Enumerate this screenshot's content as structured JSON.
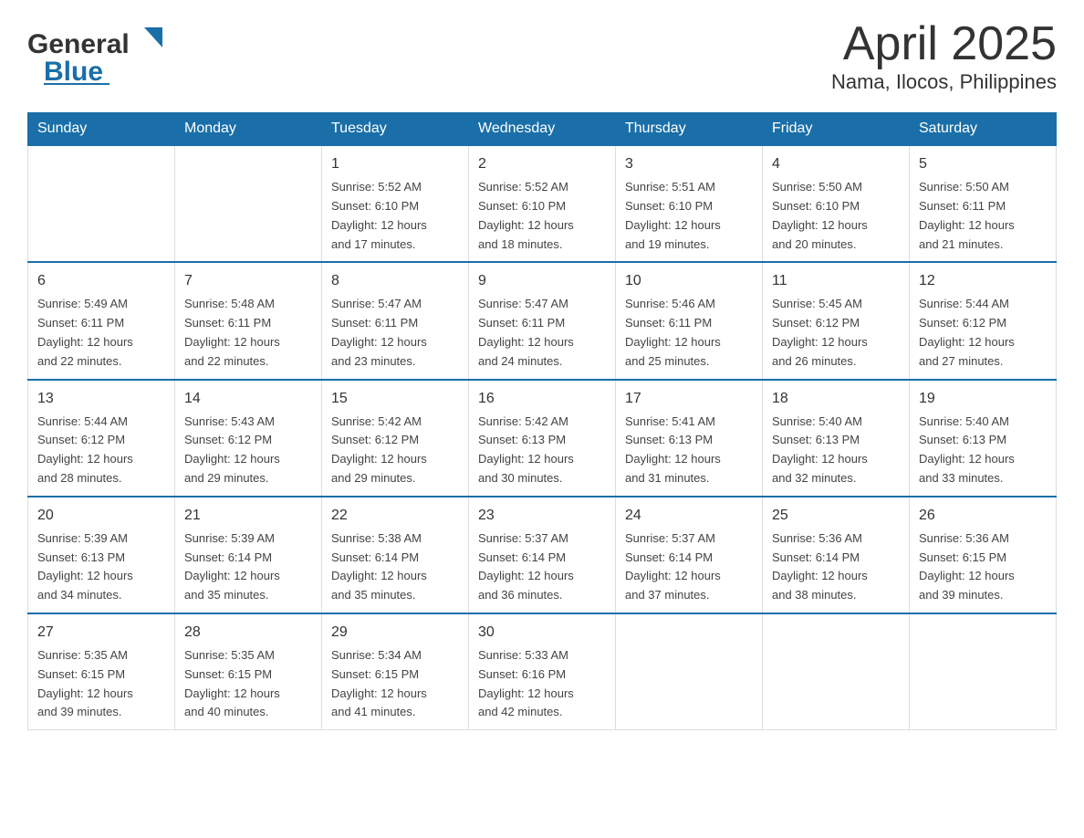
{
  "header": {
    "logo_general": "General",
    "logo_blue": "Blue",
    "month_title": "April 2025",
    "location": "Nama, Ilocos, Philippines"
  },
  "days_of_week": [
    "Sunday",
    "Monday",
    "Tuesday",
    "Wednesday",
    "Thursday",
    "Friday",
    "Saturday"
  ],
  "weeks": [
    [
      {
        "day": "",
        "info": ""
      },
      {
        "day": "",
        "info": ""
      },
      {
        "day": "1",
        "info": "Sunrise: 5:52 AM\nSunset: 6:10 PM\nDaylight: 12 hours\nand 17 minutes."
      },
      {
        "day": "2",
        "info": "Sunrise: 5:52 AM\nSunset: 6:10 PM\nDaylight: 12 hours\nand 18 minutes."
      },
      {
        "day": "3",
        "info": "Sunrise: 5:51 AM\nSunset: 6:10 PM\nDaylight: 12 hours\nand 19 minutes."
      },
      {
        "day": "4",
        "info": "Sunrise: 5:50 AM\nSunset: 6:10 PM\nDaylight: 12 hours\nand 20 minutes."
      },
      {
        "day": "5",
        "info": "Sunrise: 5:50 AM\nSunset: 6:11 PM\nDaylight: 12 hours\nand 21 minutes."
      }
    ],
    [
      {
        "day": "6",
        "info": "Sunrise: 5:49 AM\nSunset: 6:11 PM\nDaylight: 12 hours\nand 22 minutes."
      },
      {
        "day": "7",
        "info": "Sunrise: 5:48 AM\nSunset: 6:11 PM\nDaylight: 12 hours\nand 22 minutes."
      },
      {
        "day": "8",
        "info": "Sunrise: 5:47 AM\nSunset: 6:11 PM\nDaylight: 12 hours\nand 23 minutes."
      },
      {
        "day": "9",
        "info": "Sunrise: 5:47 AM\nSunset: 6:11 PM\nDaylight: 12 hours\nand 24 minutes."
      },
      {
        "day": "10",
        "info": "Sunrise: 5:46 AM\nSunset: 6:11 PM\nDaylight: 12 hours\nand 25 minutes."
      },
      {
        "day": "11",
        "info": "Sunrise: 5:45 AM\nSunset: 6:12 PM\nDaylight: 12 hours\nand 26 minutes."
      },
      {
        "day": "12",
        "info": "Sunrise: 5:44 AM\nSunset: 6:12 PM\nDaylight: 12 hours\nand 27 minutes."
      }
    ],
    [
      {
        "day": "13",
        "info": "Sunrise: 5:44 AM\nSunset: 6:12 PM\nDaylight: 12 hours\nand 28 minutes."
      },
      {
        "day": "14",
        "info": "Sunrise: 5:43 AM\nSunset: 6:12 PM\nDaylight: 12 hours\nand 29 minutes."
      },
      {
        "day": "15",
        "info": "Sunrise: 5:42 AM\nSunset: 6:12 PM\nDaylight: 12 hours\nand 29 minutes."
      },
      {
        "day": "16",
        "info": "Sunrise: 5:42 AM\nSunset: 6:13 PM\nDaylight: 12 hours\nand 30 minutes."
      },
      {
        "day": "17",
        "info": "Sunrise: 5:41 AM\nSunset: 6:13 PM\nDaylight: 12 hours\nand 31 minutes."
      },
      {
        "day": "18",
        "info": "Sunrise: 5:40 AM\nSunset: 6:13 PM\nDaylight: 12 hours\nand 32 minutes."
      },
      {
        "day": "19",
        "info": "Sunrise: 5:40 AM\nSunset: 6:13 PM\nDaylight: 12 hours\nand 33 minutes."
      }
    ],
    [
      {
        "day": "20",
        "info": "Sunrise: 5:39 AM\nSunset: 6:13 PM\nDaylight: 12 hours\nand 34 minutes."
      },
      {
        "day": "21",
        "info": "Sunrise: 5:39 AM\nSunset: 6:14 PM\nDaylight: 12 hours\nand 35 minutes."
      },
      {
        "day": "22",
        "info": "Sunrise: 5:38 AM\nSunset: 6:14 PM\nDaylight: 12 hours\nand 35 minutes."
      },
      {
        "day": "23",
        "info": "Sunrise: 5:37 AM\nSunset: 6:14 PM\nDaylight: 12 hours\nand 36 minutes."
      },
      {
        "day": "24",
        "info": "Sunrise: 5:37 AM\nSunset: 6:14 PM\nDaylight: 12 hours\nand 37 minutes."
      },
      {
        "day": "25",
        "info": "Sunrise: 5:36 AM\nSunset: 6:14 PM\nDaylight: 12 hours\nand 38 minutes."
      },
      {
        "day": "26",
        "info": "Sunrise: 5:36 AM\nSunset: 6:15 PM\nDaylight: 12 hours\nand 39 minutes."
      }
    ],
    [
      {
        "day": "27",
        "info": "Sunrise: 5:35 AM\nSunset: 6:15 PM\nDaylight: 12 hours\nand 39 minutes."
      },
      {
        "day": "28",
        "info": "Sunrise: 5:35 AM\nSunset: 6:15 PM\nDaylight: 12 hours\nand 40 minutes."
      },
      {
        "day": "29",
        "info": "Sunrise: 5:34 AM\nSunset: 6:15 PM\nDaylight: 12 hours\nand 41 minutes."
      },
      {
        "day": "30",
        "info": "Sunrise: 5:33 AM\nSunset: 6:16 PM\nDaylight: 12 hours\nand 42 minutes."
      },
      {
        "day": "",
        "info": ""
      },
      {
        "day": "",
        "info": ""
      },
      {
        "day": "",
        "info": ""
      }
    ]
  ],
  "colors": {
    "header_bg": "#1a6fa8",
    "header_text": "#ffffff",
    "border_top": "#1a6fa8",
    "text_main": "#333333"
  }
}
